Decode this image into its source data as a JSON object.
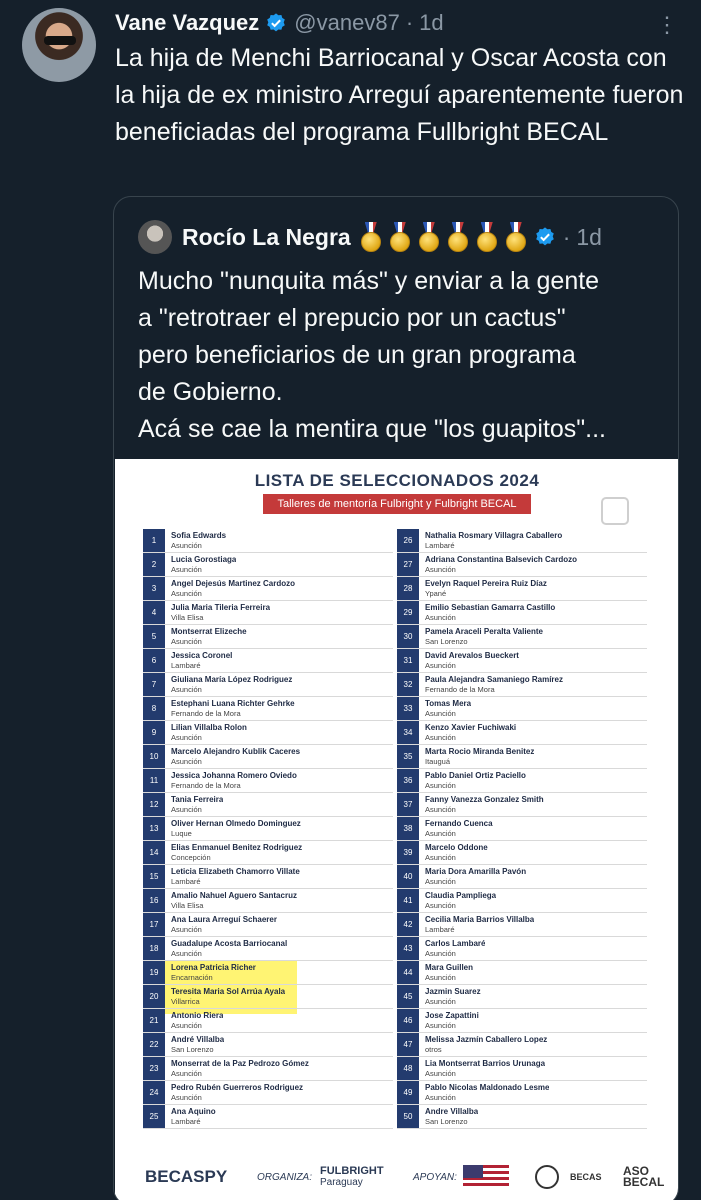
{
  "tweet": {
    "author_name": "Vane Vazquez",
    "handle": "@vanev87",
    "time": "1d",
    "text": "La hija de Menchi Barriocanal y Oscar Acosta con la hija de ex ministro Arreguí aparentemente fueron beneficiadas del programa Fullbright BECAL"
  },
  "quote": {
    "author_name": "Rocío La Negra",
    "time": "1d",
    "medal_count": 6,
    "text_lines": [
      "Mucho \"nunquita más\" y enviar a la gente",
      "a \"retrotraer el prepucio por un cactus\"",
      "pero beneficiarios de un gran programa",
      "de Gobierno.",
      "Acá se cae la mentira que \"los guapitos\"..."
    ]
  },
  "document": {
    "title": "LISTA DE SELECCIONADOS 2024",
    "subtitle": "Talleres de mentoría Fulbright y Fulbright BECAL",
    "highlight_color": "#ffeb00",
    "header_color": "#233b6e",
    "left": [
      {
        "n": "1",
        "name": "Sofia Edwards",
        "city": "Asunción"
      },
      {
        "n": "2",
        "name": "Lucia Gorostiaga",
        "city": "Asunción"
      },
      {
        "n": "3",
        "name": "Angel Dejesús Martinez Cardozo",
        "city": "Asunción"
      },
      {
        "n": "4",
        "name": "Julia Maria Tileria Ferreira",
        "city": "Villa Elisa"
      },
      {
        "n": "5",
        "name": "Montserrat Elizeche",
        "city": "Asunción"
      },
      {
        "n": "6",
        "name": "Jessica Coronel",
        "city": "Lambaré"
      },
      {
        "n": "7",
        "name": "Giuliana María López Rodriguez",
        "city": "Asunción"
      },
      {
        "n": "8",
        "name": "Estephani Luana Richter Gehrke",
        "city": "Fernando de la Mora"
      },
      {
        "n": "9",
        "name": "Lilian Villalba Rolon",
        "city": "Asunción"
      },
      {
        "n": "10",
        "name": "Marcelo Alejandro Kublik Caceres",
        "city": "Asunción"
      },
      {
        "n": "11",
        "name": "Jessica Johanna Romero Oviedo",
        "city": "Fernando de la Mora"
      },
      {
        "n": "12",
        "name": "Tania Ferreira",
        "city": "Asunción"
      },
      {
        "n": "13",
        "name": "Oliver Hernan Olmedo Dominguez",
        "city": "Luque"
      },
      {
        "n": "14",
        "name": "Elias Enmanuel Benitez Rodriguez",
        "city": "Concepción"
      },
      {
        "n": "15",
        "name": "Leticia Elizabeth Chamorro Villate",
        "city": "Lambaré"
      },
      {
        "n": "16",
        "name": "Amalio Nahuel Aguero Santacruz",
        "city": "Villa Elisa"
      },
      {
        "n": "17",
        "name": "Ana Laura Arreguí Schaerer",
        "city": "Asunción"
      },
      {
        "n": "18",
        "name": "Guadalupe Acosta Barriocanal",
        "city": "Asunción"
      },
      {
        "n": "19",
        "name": "Lorena Patricia Richer",
        "city": "Encarnación"
      },
      {
        "n": "20",
        "name": "Teresita Maria Sol Arrúa Ayala",
        "city": "Villarrica"
      },
      {
        "n": "21",
        "name": "Antonio Riera",
        "city": "Asunción"
      },
      {
        "n": "22",
        "name": "André Villalba",
        "city": "San Lorenzo"
      },
      {
        "n": "23",
        "name": "Monserrat de la Paz Pedrozo Gómez",
        "city": "Asunción"
      },
      {
        "n": "24",
        "name": "Pedro Rubén Guerreros Rodriguez",
        "city": "Asunción"
      },
      {
        "n": "25",
        "name": "Ana Aquino",
        "city": "Lambaré"
      }
    ],
    "right": [
      {
        "n": "26",
        "name": "Nathalia Rosmary Villagra Caballero",
        "city": "Lambaré"
      },
      {
        "n": "27",
        "name": "Adriana Constantina Balsevich Cardozo",
        "city": "Asunción"
      },
      {
        "n": "28",
        "name": "Evelyn Raquel Pereira Ruiz Díaz",
        "city": "Ypané"
      },
      {
        "n": "29",
        "name": "Emilio Sebastian Gamarra Castillo",
        "city": "Asunción"
      },
      {
        "n": "30",
        "name": "Pamela Araceli Peralta Valiente",
        "city": "San Lorenzo"
      },
      {
        "n": "31",
        "name": "David Arevalos Bueckert",
        "city": "Asunción"
      },
      {
        "n": "32",
        "name": "Paula Alejandra Samaniego Ramírez",
        "city": "Fernando de la Mora"
      },
      {
        "n": "33",
        "name": "Tomas Mera",
        "city": "Asunción"
      },
      {
        "n": "34",
        "name": "Kenzo Xavier Fuchiwaki",
        "city": "Asunción"
      },
      {
        "n": "35",
        "name": "Marta Rocio Miranda Benitez",
        "city": "Itauguá"
      },
      {
        "n": "36",
        "name": "Pablo Daniel Ortiz Paciello",
        "city": "Asunción"
      },
      {
        "n": "37",
        "name": "Fanny Vanezza Gonzalez Smith",
        "city": "Asunción"
      },
      {
        "n": "38",
        "name": "Fernando Cuenca",
        "city": "Asunción"
      },
      {
        "n": "39",
        "name": "Marcelo Oddone",
        "city": "Asunción"
      },
      {
        "n": "40",
        "name": "Maria Dora Amarilla Pavón",
        "city": "Asunción"
      },
      {
        "n": "41",
        "name": "Claudia Pampliega",
        "city": "Asunción"
      },
      {
        "n": "42",
        "name": "Cecilia Maria Barrios Villalba",
        "city": "Lambaré"
      },
      {
        "n": "43",
        "name": "Carlos Lambaré",
        "city": "Asunción"
      },
      {
        "n": "44",
        "name": "Mara Guillen",
        "city": "Asunción"
      },
      {
        "n": "45",
        "name": "Jazmin Suarez",
        "city": "Asunción"
      },
      {
        "n": "46",
        "name": "Jose Zapattini",
        "city": "Asunción"
      },
      {
        "n": "47",
        "name": "Melissa Jazmín Caballero Lopez",
        "city": "otros"
      },
      {
        "n": "48",
        "name": "Lia Montserrat Barrios Urunaga",
        "city": "Asunción"
      },
      {
        "n": "49",
        "name": "Pablo Nicolas Maldonado Lesme",
        "city": "Asunción"
      },
      {
        "n": "50",
        "name": "Andre Villalba",
        "city": "San Lorenzo"
      }
    ],
    "footer": {
      "becaspy": "BECASPY",
      "organiza": "ORGANIZA:",
      "fulbright": "FULBRIGHT",
      "paraguay": "Paraguay",
      "apoyan": "APOYAN:",
      "becas": "BECAS",
      "becal": "BECAL",
      "aso": "ASO"
    }
  }
}
